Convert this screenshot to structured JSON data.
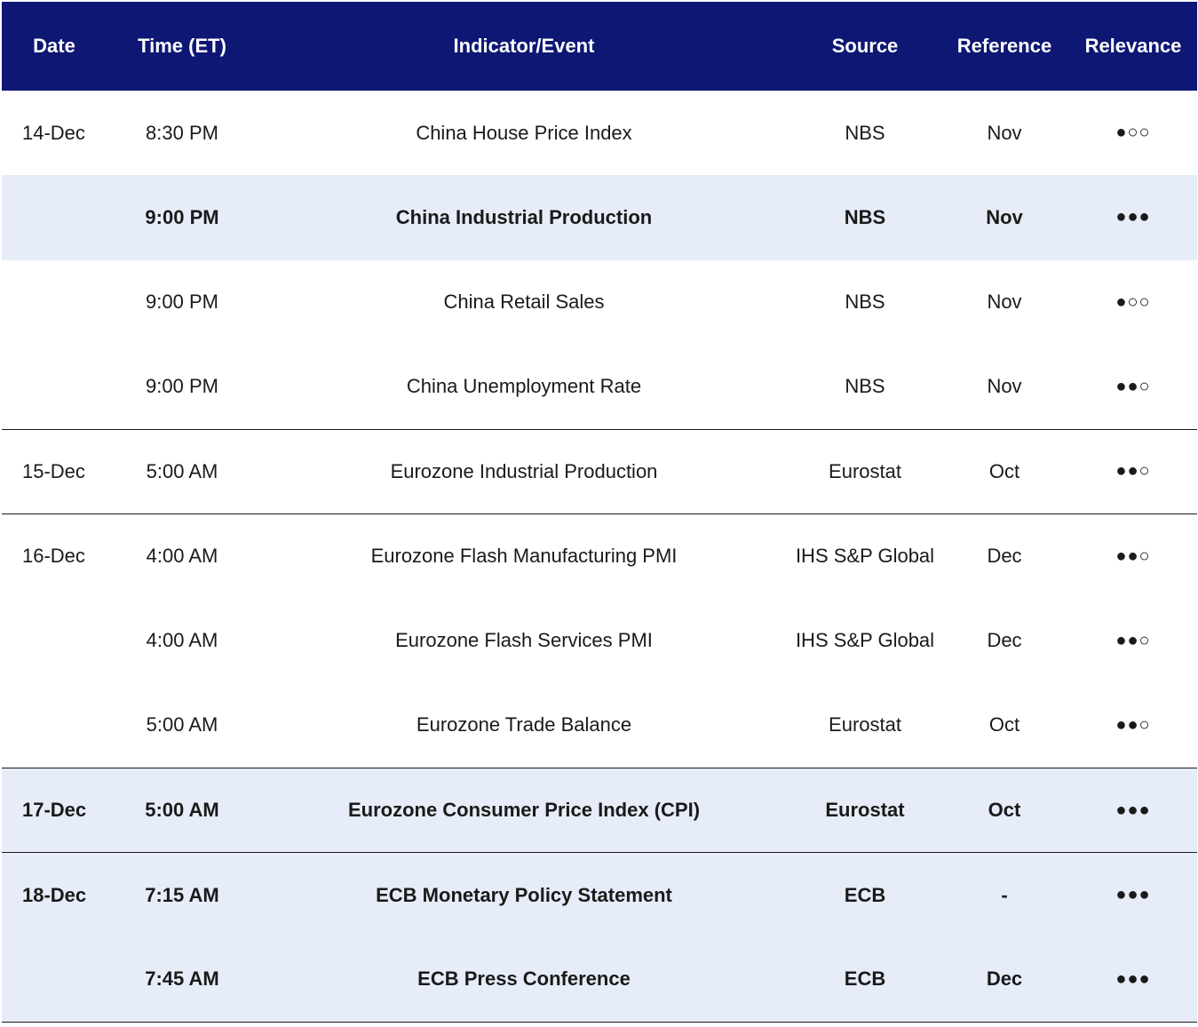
{
  "table": {
    "headers": [
      "Date",
      "Time (ET)",
      "Indicator/Event",
      "Source",
      "Reference",
      "Relevance"
    ],
    "rows": [
      {
        "date": "14-Dec",
        "time": "8:30 PM",
        "indicator": "China House Price Index",
        "source": "NBS",
        "reference": "Nov",
        "relevance": "●○○"
      },
      {
        "date": "",
        "time": "9:00 PM",
        "indicator": "China Industrial Production",
        "source": "NBS",
        "reference": "Nov",
        "relevance": "●●●"
      },
      {
        "date": "",
        "time": "9:00 PM",
        "indicator": "China Retail Sales",
        "source": "NBS",
        "reference": "Nov",
        "relevance": "●○○"
      },
      {
        "date": "",
        "time": "9:00 PM",
        "indicator": "China Unemployment Rate",
        "source": "NBS",
        "reference": "Nov",
        "relevance": "●●○"
      },
      {
        "date": "15-Dec",
        "time": "5:00 AM",
        "indicator": "Eurozone Industrial Production",
        "source": "Eurostat",
        "reference": "Oct",
        "relevance": "●●○"
      },
      {
        "date": "16-Dec",
        "time": "4:00 AM",
        "indicator": "Eurozone Flash Manufacturing PMI",
        "source": "IHS S&P Global",
        "reference": "Dec",
        "relevance": "●●○"
      },
      {
        "date": "",
        "time": "4:00 AM",
        "indicator": "Eurozone Flash Services PMI",
        "source": "IHS S&P Global",
        "reference": "Dec",
        "relevance": "●●○"
      },
      {
        "date": "",
        "time": "5:00 AM",
        "indicator": "Eurozone Trade Balance",
        "source": "Eurostat",
        "reference": "Oct",
        "relevance": "●●○"
      },
      {
        "date": "17-Dec",
        "time": "5:00 AM",
        "indicator": "Eurozone Consumer Price Index (CPI)",
        "source": "Eurostat",
        "reference": "Oct",
        "relevance": "●●●"
      },
      {
        "date": "18-Dec",
        "time": "7:15 AM",
        "indicator": "ECB Monetary Policy Statement",
        "source": "ECB",
        "reference": "-",
        "relevance": "●●●"
      },
      {
        "date": "",
        "time": "7:45 AM",
        "indicator": "ECB Press Conference",
        "source": "ECB",
        "reference": "Dec",
        "relevance": "●●●"
      }
    ]
  },
  "colors": {
    "header_bg": "#0e1774",
    "header_text": "#ffffff",
    "highlight_row_bg": "#e6ecf8",
    "divider": "#1a1a1a"
  }
}
